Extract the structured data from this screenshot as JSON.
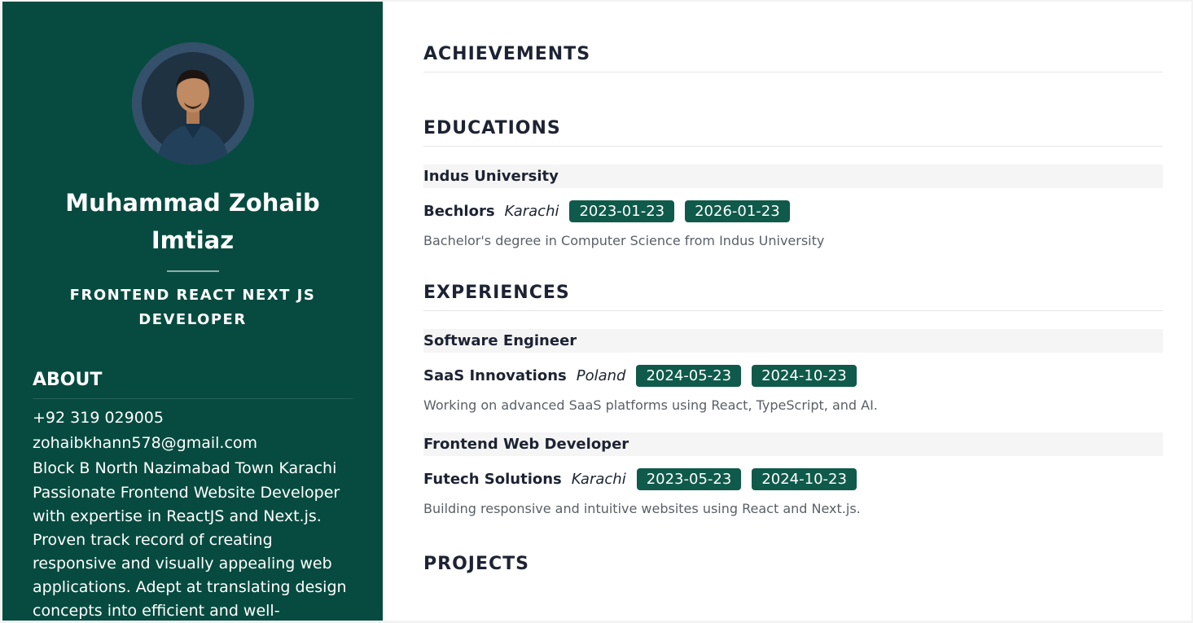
{
  "profile": {
    "name": "Muhammad Zohaib Imtiaz",
    "role": "FRONTEND REACT NEXT JS DEVELOPER",
    "avatar_icon": "avatar-photo"
  },
  "about": {
    "title": "ABOUT",
    "phone": "+92 319 029005",
    "email": "zohaibkhann578@gmail.com",
    "address": "Block B North Nazimabad Town Karachi",
    "summary": "Passionate Frontend Website Developer with expertise in ReactJS and Next.js. Proven track record of creating responsive and visually appealing web applications. Adept at translating design concepts into efficient and well-"
  },
  "achievements": {
    "title": "ACHIEVEMENTS"
  },
  "educations": {
    "title": "EDUCATIONS",
    "items": [
      {
        "institution": "Indus University",
        "degree": "Bechlors",
        "location": "Karachi",
        "start": "2023-01-23",
        "end": "2026-01-23",
        "description": "Bachelor's degree in Computer Science from Indus University"
      }
    ]
  },
  "experiences": {
    "title": "EXPERIENCES",
    "items": [
      {
        "position": "Software Engineer",
        "company": "SaaS Innovations",
        "location": "Poland",
        "start": "2024-05-23",
        "end": "2024-10-23",
        "description": "Working on advanced SaaS platforms using React, TypeScript, and AI."
      },
      {
        "position": "Frontend Web Developer",
        "company": "Futech Solutions",
        "location": "Karachi",
        "start": "2023-05-23",
        "end": "2024-10-23",
        "description": "Building responsive and intuitive websites using React and Next.js."
      }
    ]
  },
  "projects": {
    "title": "PROJECTS"
  },
  "colors": {
    "sidebar": "#074b40",
    "badge": "#0f5a4b",
    "heading": "#1d2333"
  }
}
